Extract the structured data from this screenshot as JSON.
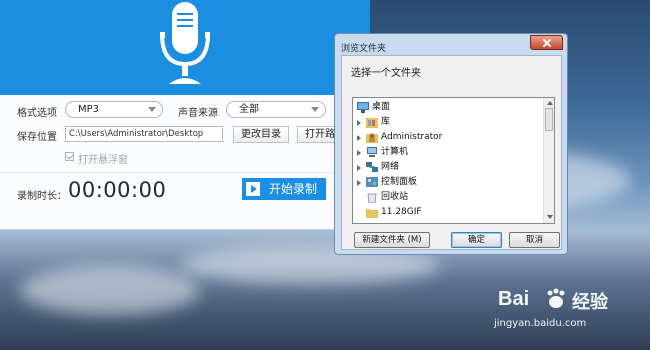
{
  "recorder": {
    "format_label": "格式选项",
    "format_value": "MP3",
    "source_label": "声音来源",
    "source_value": "全部",
    "save_label": "保存位置",
    "save_path": "C:\\Users\\Administrator\\Desktop",
    "change_dir_button": "更改目录",
    "open_path_button": "打开路",
    "floating_window_label": "打开悬浮窗",
    "duration_label": "录制时长：",
    "timer": "00:00:00",
    "start_button": "开始录制",
    "header_color": "#1b8ee0"
  },
  "dialog": {
    "title": "浏览文件夹",
    "prompt": "选择一个文件夹",
    "tree": [
      {
        "label": "桌面",
        "icon": "desktop-icon",
        "expandable": false,
        "selected": true
      },
      {
        "label": "库",
        "icon": "library-icon",
        "expandable": true
      },
      {
        "label": "Administrator",
        "icon": "user-folder-icon",
        "expandable": true
      },
      {
        "label": "计算机",
        "icon": "computer-icon",
        "expandable": true
      },
      {
        "label": "网络",
        "icon": "network-icon",
        "expandable": true
      },
      {
        "label": "控制面板",
        "icon": "control-panel-icon",
        "expandable": true
      },
      {
        "label": "回收站",
        "icon": "recycle-bin-icon",
        "expandable": false
      },
      {
        "label": "11.28GIF",
        "icon": "folder-icon",
        "expandable": false
      }
    ],
    "new_folder_button": "新建文件夹 (M)",
    "ok_button": "确定",
    "cancel_button": "取消"
  },
  "watermark": {
    "brand": "Bai",
    "brand_suffix": "经验",
    "url": "jingyan.baidu.com"
  }
}
